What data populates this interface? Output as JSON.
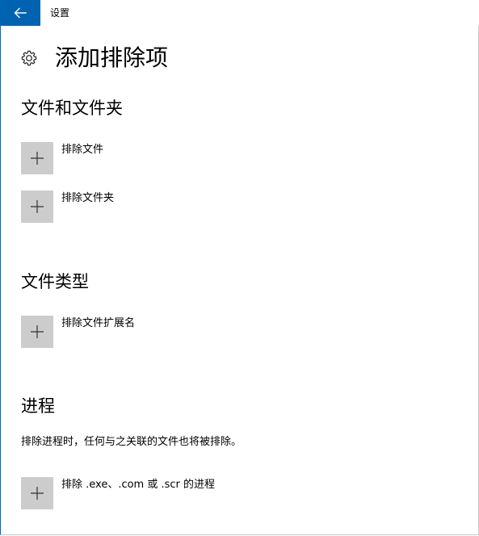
{
  "window": {
    "title": "设置"
  },
  "page": {
    "title": "添加排除项"
  },
  "sections": {
    "files": {
      "heading": "文件和文件夹",
      "items": [
        {
          "label": "排除文件"
        },
        {
          "label": "排除文件夹"
        }
      ]
    },
    "file_types": {
      "heading": "文件类型",
      "items": [
        {
          "label": "排除文件扩展名"
        }
      ]
    },
    "processes": {
      "heading": "进程",
      "description": "排除进程时，任何与之关联的文件也将被排除。",
      "items": [
        {
          "label": "排除 .exe、.com 或 .scr 的进程"
        }
      ]
    }
  },
  "icons": {
    "back": "back-arrow-icon",
    "settings": "gear-icon",
    "add": "plus-icon"
  },
  "colors": {
    "accent": "#0063b1",
    "tile": "#cccccc"
  }
}
